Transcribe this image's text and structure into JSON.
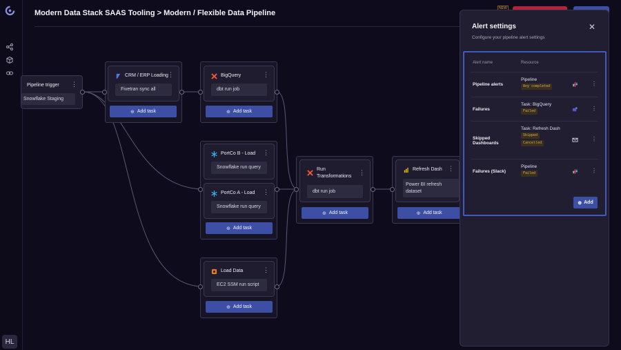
{
  "header": {
    "breadcrumb": "Modern Data Stack SAAS Tooling > Modern / Flexible Data Pipeline",
    "new_badge": "NEW"
  },
  "sidebar": {
    "avatar_initials": "HL"
  },
  "pipeline": {
    "add_task_label": "Add task",
    "trigger": {
      "title": "Pipeline trigger",
      "sub": "Snowflake Staging"
    },
    "crm": {
      "title": "CRM / ERP Loading",
      "sub": "Fivetran sync all"
    },
    "bigquery": {
      "title": "BigQuery",
      "sub": "dbt run job"
    },
    "portco_b": {
      "title": "PortCo B - Load",
      "sub": "Snowflake run query"
    },
    "portco_a": {
      "title": "PortCo A - Load",
      "sub": "Snowflake run query"
    },
    "load_data": {
      "title": "Load Data",
      "sub": "EC2 SSM run script"
    },
    "run_transformations": {
      "title": "Run Transformations",
      "sub": "dbt run job"
    },
    "refresh_dash": {
      "title": "Refresh Dash",
      "sub": "Power BI refresh dataset"
    }
  },
  "alert_panel": {
    "title": "Alert settings",
    "description": "Configure your pipeline alert settings",
    "col_alert_name": "Alert name",
    "col_resource": "Resource",
    "add_label": "Add",
    "rows": [
      {
        "name": "Pipeline alerts",
        "resource": "Pipeline",
        "tags": [
          "Any completed"
        ],
        "channel": "slack-icon"
      },
      {
        "name": "Failures",
        "resource": "Task: BigQuery",
        "tags": [
          "Failed"
        ],
        "channel": "teams-icon"
      },
      {
        "name": "Skipped Dashboards",
        "resource": "Task: Refresh Dash",
        "tags": [
          "Skipped",
          "Cancelled"
        ],
        "channel": "mail-icon"
      },
      {
        "name": "Failures (Slack)",
        "resource": "Pipeline",
        "tags": [
          "Failed"
        ],
        "channel": "slack-icon"
      }
    ]
  },
  "colors": {
    "accent": "#3c4fa5",
    "highlight_border": "#3f5bc2",
    "tag_text": "#d8a84c",
    "background": "#0e0c1c"
  }
}
